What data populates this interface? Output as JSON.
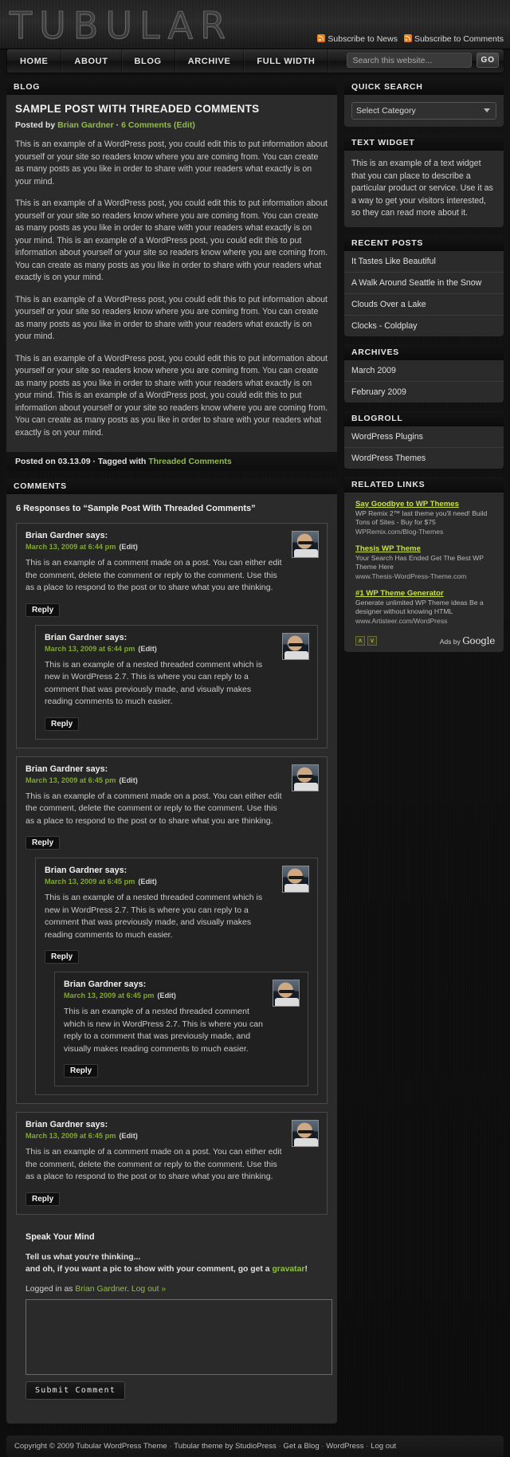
{
  "site": {
    "logo_text": "TUBULAR"
  },
  "header": {
    "subscribe_news": "Subscribe to News",
    "subscribe_comments": "Subscribe to Comments"
  },
  "nav": {
    "items": [
      "HOME",
      "ABOUT",
      "BLOG",
      "ARCHIVE",
      "FULL WIDTH"
    ]
  },
  "search": {
    "placeholder": "Search this website...",
    "value": "",
    "go_label": "GO"
  },
  "content": {
    "panel_title": "BLOG",
    "post": {
      "title": "SAMPLE POST WITH THREADED COMMENTS",
      "meta_prefix": "Posted by",
      "author": "Brian Gardner",
      "meta_sep": "·",
      "comments_link": "6 Comments (Edit)",
      "paragraphs": [
        "This is an example of a WordPress post, you could edit this to put information about yourself or your site so readers know where you are coming from. You can create as many posts as you like in order to share with your readers what exactly is on your mind.",
        "This is an example of a WordPress post, you could edit this to put information about yourself or your site so readers know where you are coming from. You can create as many posts as you like in order to share with your readers what exactly is on your mind. This is an example of a WordPress post, you could edit this to put information about yourself or your site so readers know where you are coming from. You can create as many posts as you like in order to share with your readers what exactly is on your mind.",
        "This is an example of a WordPress post, you could edit this to put information about yourself or your site so readers know where you are coming from. You can create as many posts as you like in order to share with your readers what exactly is on your mind.",
        "This is an example of a WordPress post, you could edit this to put information about yourself or your site so readers know where you are coming from. You can create as many posts as you like in order to share with your readers what exactly is on your mind. This is an example of a WordPress post, you could edit this to put information about yourself or your site so readers know where you are coming from. You can create as many posts as you like in order to share with your readers what exactly is on your mind."
      ],
      "footer_prefix": "Posted on 03.13.09 · Tagged with",
      "tag": "Threaded Comments"
    }
  },
  "comments": {
    "panel_title": "COMMENTS",
    "responses_heading": "6 Responses to “Sample Post With Threaded Comments”",
    "reply_label": "Reply",
    "edit_label": "(Edit)",
    "says_suffix": "says:",
    "text_top": "This is an example of a comment made on a post. You can either edit the comment, delete the comment or reply to the comment. Use this as a place to respond to the post or to share what you are thinking.",
    "text_nested": "This is an example of a nested threaded comment which is new in WordPress 2.7. This is where you can reply to a comment that was previously made, and visually makes reading comments to much easier.",
    "threads": [
      {
        "author": "Brian Gardner",
        "date": "March 13, 2009 at 6:44 pm",
        "text": "This is an example of a comment made on a post. You can either edit the comment, delete the comment or reply to the comment. Use this as a place to respond to the post or to share what you are thinking.",
        "children": [
          {
            "author": "Brian Gardner",
            "date": "March 13, 2009 at 6:44 pm",
            "text": "This is an example of a nested threaded comment which is new in WordPress 2.7. This is where you can reply to a comment that was previously made, and visually makes reading comments to much easier.",
            "children": []
          }
        ]
      },
      {
        "author": "Brian Gardner",
        "date": "March 13, 2009 at 6:45 pm",
        "text": "This is an example of a comment made on a post. You can either edit the comment, delete the comment or reply to the comment. Use this as a place to respond to the post or to share what you are thinking.",
        "children": [
          {
            "author": "Brian Gardner",
            "date": "March 13, 2009 at 6:45 pm",
            "text": "This is an example of a nested threaded comment which is new in WordPress 2.7. This is where you can reply to a comment that was previously made, and visually makes reading comments to much easier.",
            "children": [
              {
                "author": "Brian Gardner",
                "date": "March 13, 2009 at 6:45 pm",
                "text": "This is an example of a nested threaded comment which is new in WordPress 2.7. This is where you can reply to a comment that was previously made, and visually makes reading comments to much easier.",
                "children": []
              }
            ]
          }
        ]
      },
      {
        "author": "Brian Gardner",
        "date": "March 13, 2009 at 6:45 pm",
        "text": "This is an example of a comment made on a post. You can either edit the comment, delete the comment or reply to the comment. Use this as a place to respond to the post or to share what you are thinking.",
        "children": []
      }
    ]
  },
  "respond": {
    "title": "Speak Your Mind",
    "note_line1": "Tell us what you're thinking...",
    "note_line2_pre": "and oh, if you want a pic to show with your comment, go get a",
    "note_gravatar": "gravatar",
    "note_line2_post": "!",
    "logged_in_pre": "Logged in as",
    "logged_in_user": "Brian Gardner",
    "logged_in_dot": ".",
    "logout_label": "Log out »",
    "textarea_value": "",
    "submit_label": "Submit Comment"
  },
  "sidebar": {
    "quick_search": {
      "title": "QUICK SEARCH",
      "selected": "Select Category",
      "options": [
        "Select Category"
      ]
    },
    "text_widget": {
      "title": "TEXT WIDGET",
      "body": "This is an example of a text widget that you can place to describe a particular product or service. Use it as a way to get your visitors interested, so they can read more about it."
    },
    "recent_posts": {
      "title": "RECENT POSTS",
      "items": [
        "It Tastes Like Beautiful",
        "A Walk Around Seattle in the Snow",
        "Clouds Over a Lake",
        "Clocks - Coldplay"
      ]
    },
    "archives": {
      "title": "ARCHIVES",
      "items": [
        "March 2009",
        "February 2009"
      ]
    },
    "blogroll": {
      "title": "BLOGROLL",
      "items": [
        "WordPress Plugins",
        "WordPress Themes"
      ]
    },
    "related_links": {
      "title": "RELATED LINKS",
      "ads": [
        {
          "title": "Say Goodbye to WP Themes",
          "desc": "WP Remix 2™ last theme you'll need! Build Tons of Sites - Buy for $75",
          "url": "WPRemix.com/Blog-Themes"
        },
        {
          "title": "Thesis WP Theme",
          "desc": "Your Search Has Ended Get The Best WP Theme Here",
          "url": "www.Thesis-WordPress-Theme.com"
        },
        {
          "title": "#1 WP Theme Generator",
          "desc": "Generate unlimited WP Theme ideas Be a designer without knowing HTML",
          "url": "www.Artisteer.com/WordPress"
        }
      ],
      "up_arrow": "ʌ",
      "down_arrow": "v",
      "ads_by_pre": "Ads by",
      "ads_by_brand": "Google"
    }
  },
  "footer": {
    "copyright": "Copyright © 2009 Tubular WordPress Theme",
    "links": [
      "Tubular theme by StudioPress",
      "Get a Blog",
      "WordPress",
      "Log out"
    ],
    "sep": "·"
  }
}
